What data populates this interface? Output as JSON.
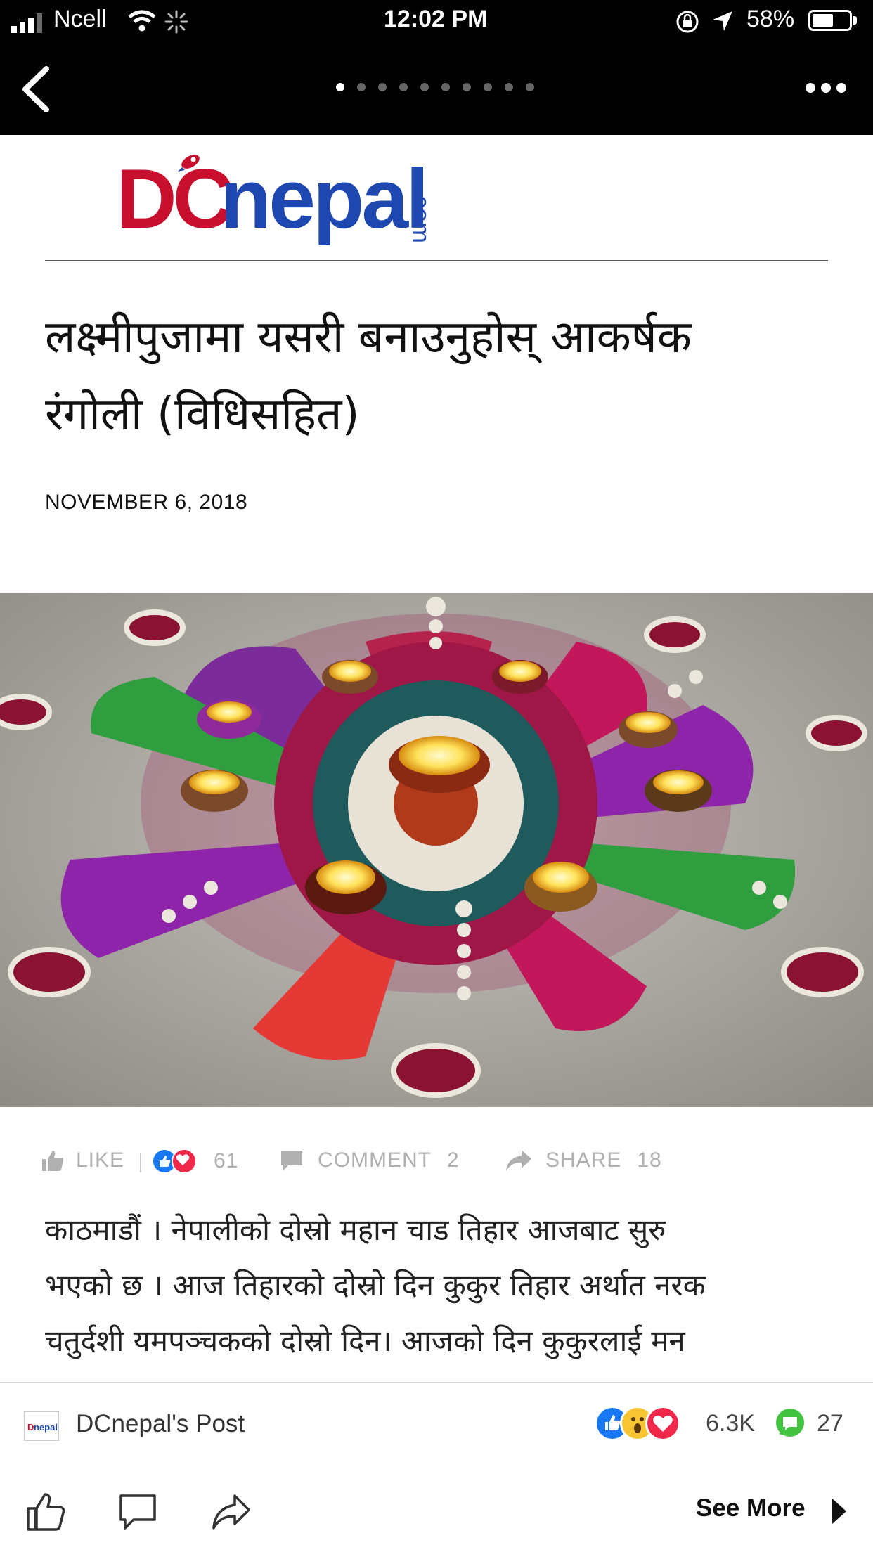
{
  "status_bar": {
    "carrier": "Ncell",
    "time": "12:02 PM",
    "battery": "58%",
    "battery_level": 0.58
  },
  "nav": {
    "back_icon": "chevron-left-icon",
    "page_dots": 10,
    "active_dot": 0,
    "more_icon": "more-dots-icon"
  },
  "article": {
    "logo_text_d": "DC",
    "logo_text_nepal": "nepal",
    "logo_text_com": ".com",
    "title_line1": "लक्ष्मीपुजामा यसरी बनाउनुहोस् आकर्षक",
    "title_line2": "रंगोली (विधिसहित)",
    "date": "NOVEMBER 6, 2018",
    "body_line1": "काठमाडौं । नेपालीको दोस्रो महान चाड तिहार आजबाट सुरु",
    "body_line2": "भएको छ । आज तिहारको दोस्रो दिन कुकुर तिहार अर्थात नरक",
    "body_line3": "चतुर्दशी यमपञ्चकको दोस्रो दिन। आजको दिन कुकुरलाई मन"
  },
  "actions": {
    "like_label": "LIKE",
    "reaction_count": "61",
    "comment_label": "COMMENT",
    "comment_count": "2",
    "share_label": "SHARE",
    "share_count": "18"
  },
  "post_bar": {
    "title": "DCnepal's Post",
    "reactions_count": "6.3K",
    "comments_count": "27"
  },
  "toolbar": {
    "see_more": "See More"
  },
  "colors": {
    "brand_red": "#c8102e",
    "brand_blue": "#1f47b0",
    "fb_blue": "#1877f2",
    "love_red": "#f0284a",
    "comment_green": "#44c340"
  }
}
